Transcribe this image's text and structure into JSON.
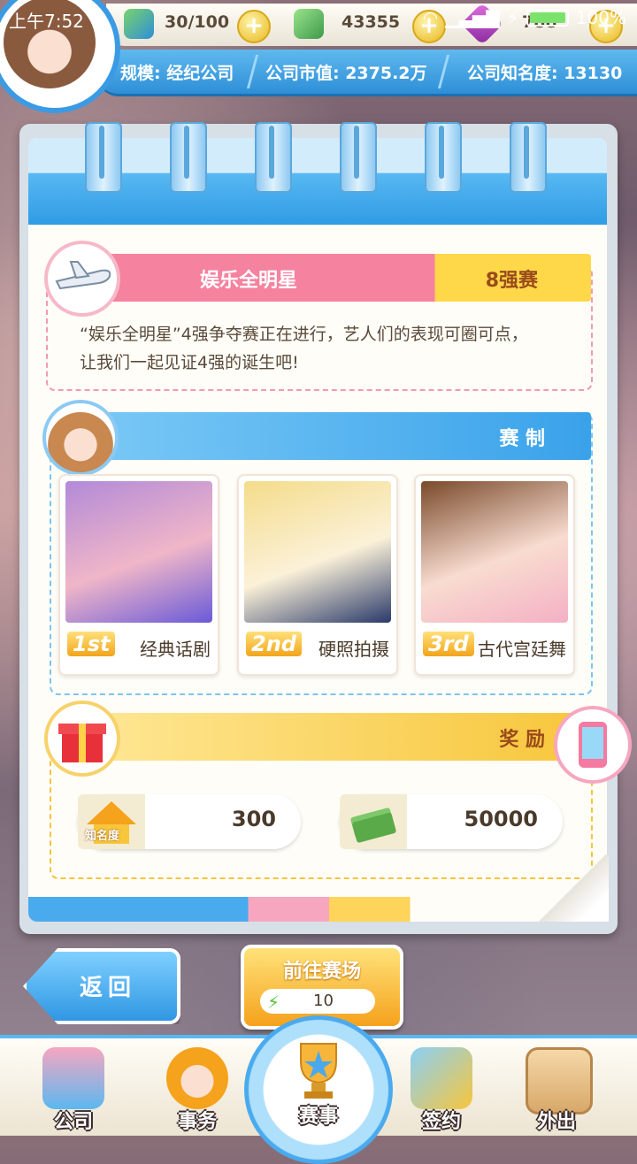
{
  "status_bar": {
    "time": "上午7:52",
    "battery": "100%",
    "battery_level": 1.0
  },
  "resources": {
    "energy": "30/100",
    "money": "43355",
    "gems": "788"
  },
  "company_info": {
    "scale": "规模: 经纪公司",
    "market_value": "公司市值: 2375.2万",
    "fame": "公司知名度: 13130"
  },
  "event": {
    "title": "娱乐全明星",
    "stage": "8强赛",
    "description_line1": "“娱乐全明星”4强争夺赛正在进行，艺人们的表现可圈可点，",
    "description_line2": "让我们一起见证4强的诞生吧!"
  },
  "format": {
    "title": "赛 制",
    "rounds": [
      {
        "rank": "1st",
        "name": "经典话剧"
      },
      {
        "rank": "2nd",
        "name": "硬照拍摄"
      },
      {
        "rank": "3rd",
        "name": "古代宫廷舞"
      }
    ]
  },
  "rewards": {
    "title": "奖 励",
    "fame_icon_label": "知名度",
    "fame_value": "300",
    "money_value": "50000"
  },
  "buttons": {
    "back": "返回",
    "go_arena": "前往赛场",
    "go_cost": "10"
  },
  "nav": [
    {
      "label": "公司",
      "icon": "building-icon"
    },
    {
      "label": "事务",
      "icon": "manager-icon"
    },
    {
      "label": "赛事",
      "icon": "trophy-icon"
    },
    {
      "label": "签约",
      "icon": "contract-icon"
    },
    {
      "label": "外出",
      "icon": "door-icon"
    }
  ],
  "colors": {
    "accent_blue": "#2f9ce5",
    "accent_pink": "#f77fa0",
    "accent_yellow": "#f5c53a"
  }
}
